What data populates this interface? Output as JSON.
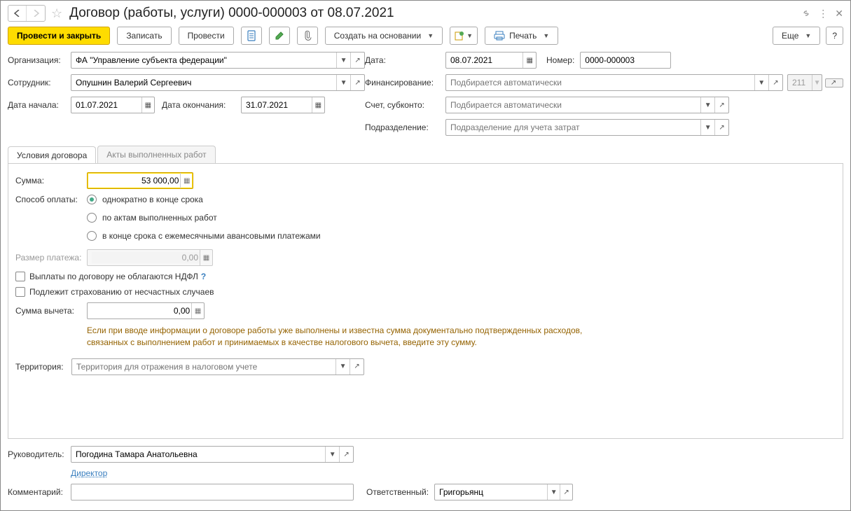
{
  "title": "Договор (работы, услуги) 0000-000003 от 08.07.2021",
  "toolbar": {
    "post_close": "Провести и закрыть",
    "write": "Записать",
    "post": "Провести",
    "create_based": "Создать на основании",
    "print": "Печать",
    "more": "Еще",
    "help": "?"
  },
  "labels": {
    "organization": "Организация:",
    "employee": "Сотрудник:",
    "date_start": "Дата начала:",
    "date_end": "Дата окончания:",
    "date": "Дата:",
    "number": "Номер:",
    "financing": "Финансирование:",
    "account": "Счет, субконто:",
    "department": "Подразделение:",
    "sum": "Cумма:",
    "pay_method": "Способ оплаты:",
    "payment_size": "Размер платежа:",
    "deduction_sum": "Сумма вычета:",
    "territory": "Территория:",
    "manager": "Руководитель:",
    "comment": "Комментарий:",
    "responsible": "Ответственный:"
  },
  "values": {
    "organization": "ФА \"Управление субъекта федерации\"",
    "employee": "Опушнин Валерий Сергеевич",
    "date_start": "01.07.2021",
    "date_end": "31.07.2021",
    "date": "08.07.2021",
    "number": "0000-000003",
    "code_disabled": "211",
    "sum": "53 000,00",
    "payment_size": "0,00",
    "deduction_sum": "0,00",
    "manager": "Погодина Тамара Анатольевна",
    "manager_position": "Директор",
    "responsible": "Григорьянц"
  },
  "placeholders": {
    "financing": "Подбирается автоматически",
    "account": "Подбирается автоматически",
    "department": "Подразделение для учета затрат",
    "territory": "Территория для отражения в налоговом учете"
  },
  "tabs": {
    "contract_terms": "Условия договора",
    "acts": "Акты выполненных работ"
  },
  "radios": {
    "once_end": "однократно в конце срока",
    "by_acts": "по актам выполненных работ",
    "monthly_adv": "в конце срока с ежемесячными авансовыми платежами"
  },
  "checkboxes": {
    "no_ndfl": "Выплаты по договору не облагаются НДФЛ",
    "insurance": "Подлежит страхованию от несчастных случаев"
  },
  "note": "Если при вводе информации о договоре работы уже выполнены и известна сумма документально подтвержденных расходов, связанных с выполнением работ и принимаемых в качестве налогового вычета, введите эту сумму."
}
